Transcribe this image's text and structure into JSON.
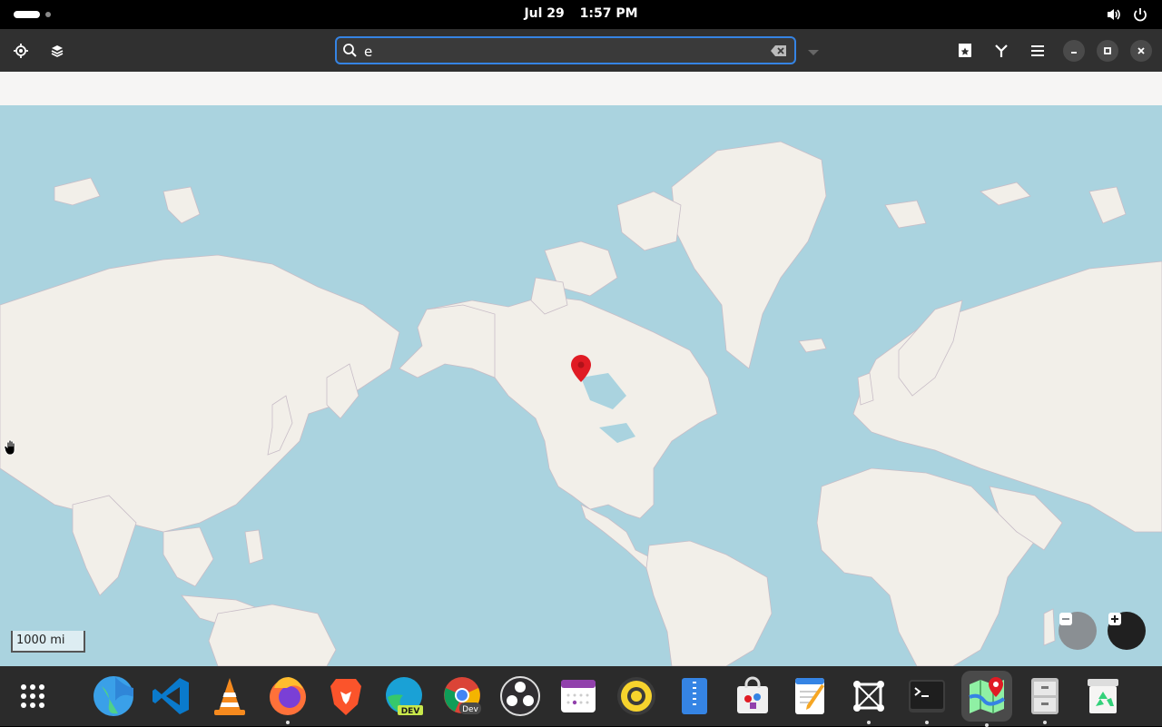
{
  "topbar": {
    "date": "Jul 29",
    "time": "1:57 PM"
  },
  "search": {
    "value": "e",
    "placeholder": ""
  },
  "map": {
    "scale_label": "1000 mi",
    "marker_color": "#e01b24",
    "water_color": "#aad3df",
    "land_color": "#f2efe9"
  },
  "dock": {
    "apps": [
      {
        "name": "web-browser",
        "running": false
      },
      {
        "name": "vscode",
        "running": false
      },
      {
        "name": "vlc",
        "running": false
      },
      {
        "name": "firefox",
        "running": true
      },
      {
        "name": "brave",
        "running": false
      },
      {
        "name": "edge-dev",
        "running": false
      },
      {
        "name": "chrome-dev",
        "running": false
      },
      {
        "name": "obs-studio",
        "running": false
      },
      {
        "name": "calendar",
        "running": false
      },
      {
        "name": "rhythmbox",
        "running": false
      },
      {
        "name": "file-archive",
        "running": false
      },
      {
        "name": "software-store",
        "running": false
      },
      {
        "name": "text-editor",
        "running": false
      },
      {
        "name": "boxes",
        "running": true
      },
      {
        "name": "terminal",
        "running": true
      },
      {
        "name": "maps",
        "running": true
      },
      {
        "name": "file-cabinet",
        "running": true
      },
      {
        "name": "trash",
        "running": false
      }
    ]
  }
}
